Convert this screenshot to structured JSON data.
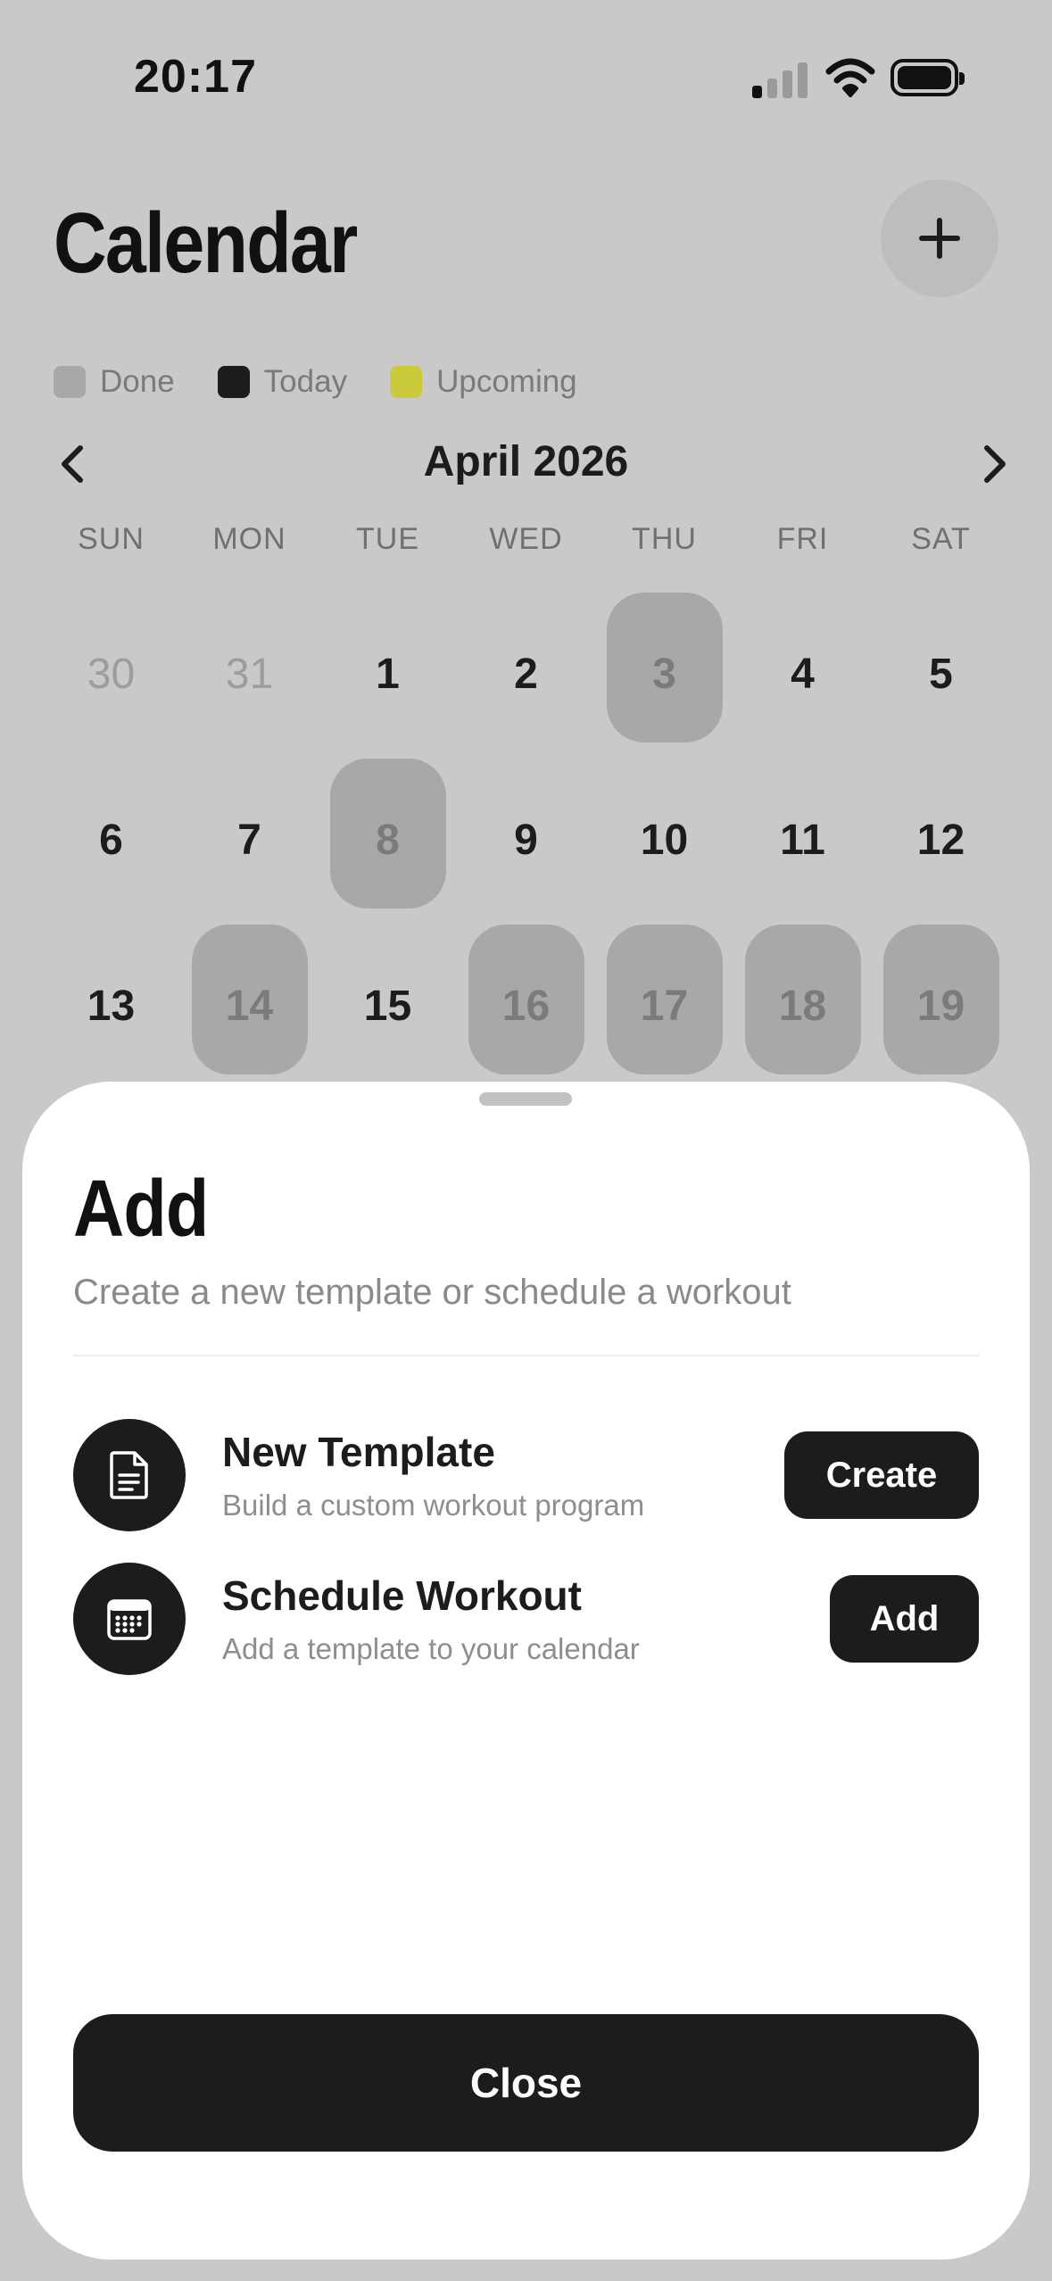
{
  "status_bar": {
    "time": "20:17",
    "signal_icon": "cellular-signal-icon",
    "wifi_icon": "wifi-icon",
    "battery_icon": "battery-icon",
    "battery_level": 1.0
  },
  "header": {
    "title": "Calendar",
    "add_icon": "plus-icon"
  },
  "legend": [
    {
      "label": "Done",
      "color": "#a8a8a8"
    },
    {
      "label": "Today",
      "color": "#1c1c1e"
    },
    {
      "label": "Upcoming",
      "color": "#cbca3d"
    }
  ],
  "calendar": {
    "month_label": "April 2026",
    "prev_icon": "chevron-left-icon",
    "next_icon": "chevron-right-icon",
    "weekdays": [
      "SUN",
      "MON",
      "TUE",
      "WED",
      "THU",
      "FRI",
      "SAT"
    ],
    "days": [
      {
        "label": "30",
        "state": "muted"
      },
      {
        "label": "31",
        "state": "muted"
      },
      {
        "label": "1",
        "state": "normal"
      },
      {
        "label": "2",
        "state": "normal"
      },
      {
        "label": "3",
        "state": "done"
      },
      {
        "label": "4",
        "state": "normal"
      },
      {
        "label": "5",
        "state": "normal"
      },
      {
        "label": "6",
        "state": "normal"
      },
      {
        "label": "7",
        "state": "normal"
      },
      {
        "label": "8",
        "state": "done"
      },
      {
        "label": "9",
        "state": "normal"
      },
      {
        "label": "10",
        "state": "normal"
      },
      {
        "label": "11",
        "state": "normal"
      },
      {
        "label": "12",
        "state": "normal"
      },
      {
        "label": "13",
        "state": "normal"
      },
      {
        "label": "14",
        "state": "done"
      },
      {
        "label": "15",
        "state": "normal"
      },
      {
        "label": "16",
        "state": "done"
      },
      {
        "label": "17",
        "state": "done"
      },
      {
        "label": "18",
        "state": "done"
      },
      {
        "label": "19",
        "state": "done"
      }
    ]
  },
  "sheet": {
    "title": "Add",
    "subtitle": "Create a new template or schedule a workout",
    "actions": [
      {
        "icon": "document-icon",
        "title": "New Template",
        "description": "Build a custom workout program",
        "button_label": "Create"
      },
      {
        "icon": "calendar-icon",
        "title": "Schedule Workout",
        "description": "Add a template to your calendar",
        "button_label": "Add"
      }
    ],
    "close_label": "Close"
  }
}
